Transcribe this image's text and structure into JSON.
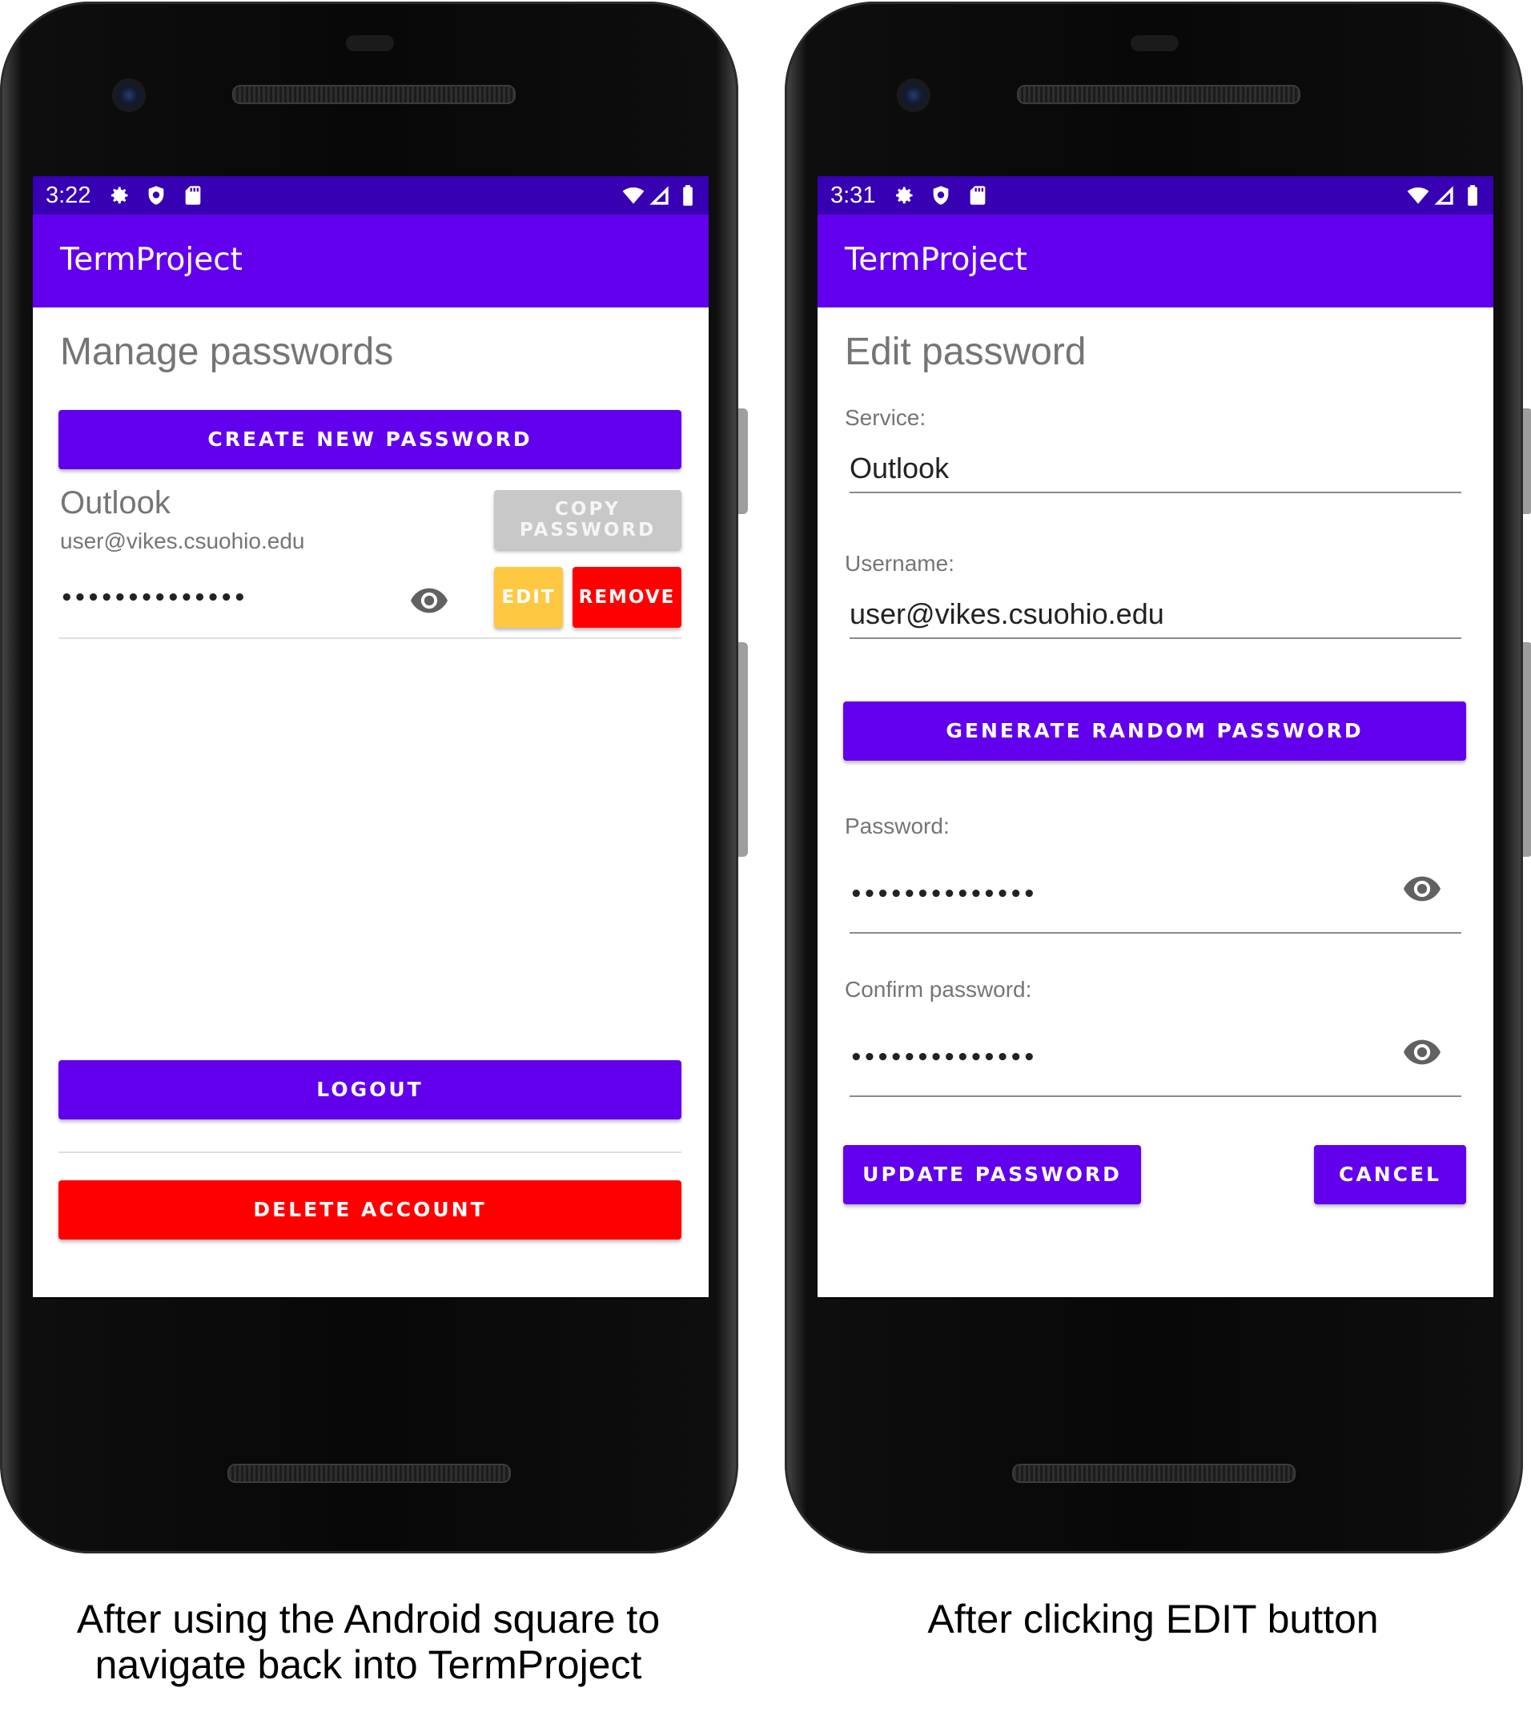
{
  "left_screen": {
    "status": {
      "time": "3:22"
    },
    "app_bar_title": "TermProject",
    "heading": "Manage passwords",
    "create_button": "CREATE NEW PASSWORD",
    "entry": {
      "service": "Outlook",
      "username": "user@vikes.csuohio.edu",
      "masked_password": "••••••••••••••",
      "copy_button": "COPY PASSWORD",
      "edit_button": "EDIT",
      "remove_button": "REMOVE"
    },
    "logout_button": "LOGOUT",
    "delete_account_button": "DELETE ACCOUNT",
    "caption": [
      "After using the Android square to",
      "navigate back into TermProject"
    ]
  },
  "right_screen": {
    "status": {
      "time": "3:31"
    },
    "app_bar_title": "TermProject",
    "heading": "Edit password",
    "service_label": "Service:",
    "service_value": "Outlook",
    "username_label": "Username:",
    "username_value": "user@vikes.csuohio.edu",
    "generate_button": "GENERATE RANDOM PASSWORD",
    "password_label": "Password:",
    "password_value": "••••••••••••••",
    "confirm_label": "Confirm password:",
    "confirm_value": "••••••••••••••",
    "update_button": "UPDATE PASSWORD",
    "cancel_button": "CANCEL",
    "caption": "After clicking EDIT button"
  },
  "status_icons": [
    "gear-icon",
    "shield-icon",
    "sd-card-icon",
    "wifi-icon",
    "signal-icon",
    "battery-icon"
  ],
  "colors": {
    "primary": "#6200ee",
    "status_bar": "#3700b3",
    "danger": "#ff0000",
    "edit": "#ffc843",
    "disabled": "#c8c8c8"
  }
}
